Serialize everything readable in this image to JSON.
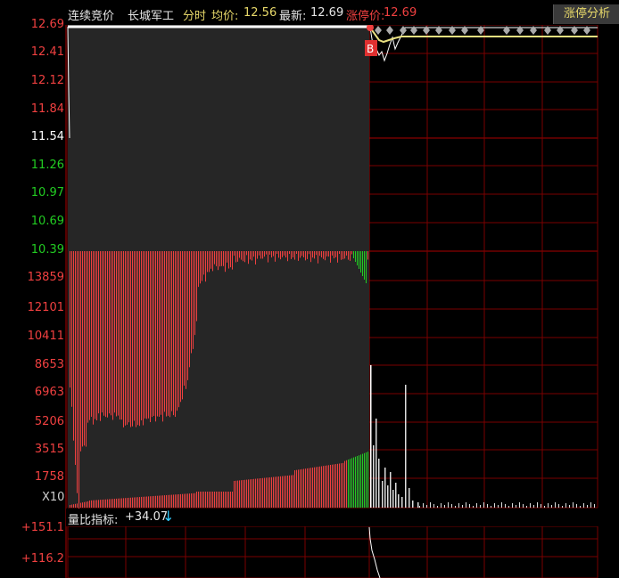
{
  "header": {
    "auction_label": "连续竞价",
    "stock_name": "长城军工",
    "mode_label": "分时",
    "avg_label": "均价:",
    "avg_value": "12.56",
    "latest_label": "最新:",
    "latest_value": "12.69",
    "limit_label": "涨停价:",
    "limit_value": "12.69",
    "analysis_button": "涨停分析"
  },
  "price_axis": {
    "ticks": [
      {
        "label": "12.69",
        "color": "#f04040"
      },
      {
        "label": "12.41",
        "color": "#f04040"
      },
      {
        "label": "12.12",
        "color": "#f04040"
      },
      {
        "label": "11.84",
        "color": "#f04040"
      },
      {
        "label": "11.54",
        "color": "#ffffff"
      },
      {
        "label": "11.26",
        "color": "#22cc22"
      },
      {
        "label": "10.97",
        "color": "#22cc22"
      },
      {
        "label": "10.69",
        "color": "#22cc22"
      },
      {
        "label": "10.39",
        "color": "#22cc22"
      }
    ]
  },
  "volume_axis": {
    "ticks": [
      "13859",
      "12101",
      "10411",
      "8653",
      "6963",
      "5206",
      "3515",
      "1758"
    ],
    "multiplier": "X10"
  },
  "indicator": {
    "title": "量比指标:",
    "value": "+34.07",
    "arrow": "↓",
    "ticks": [
      "+151.1",
      "+116.2"
    ]
  },
  "marker": {
    "label": "B"
  },
  "colors": {
    "up": "#f04040",
    "down": "#22cc22",
    "grid": "#7a0000",
    "price_line": "#ffffff",
    "avg_line": "#e8e080",
    "auction_bg": "#262626"
  }
}
